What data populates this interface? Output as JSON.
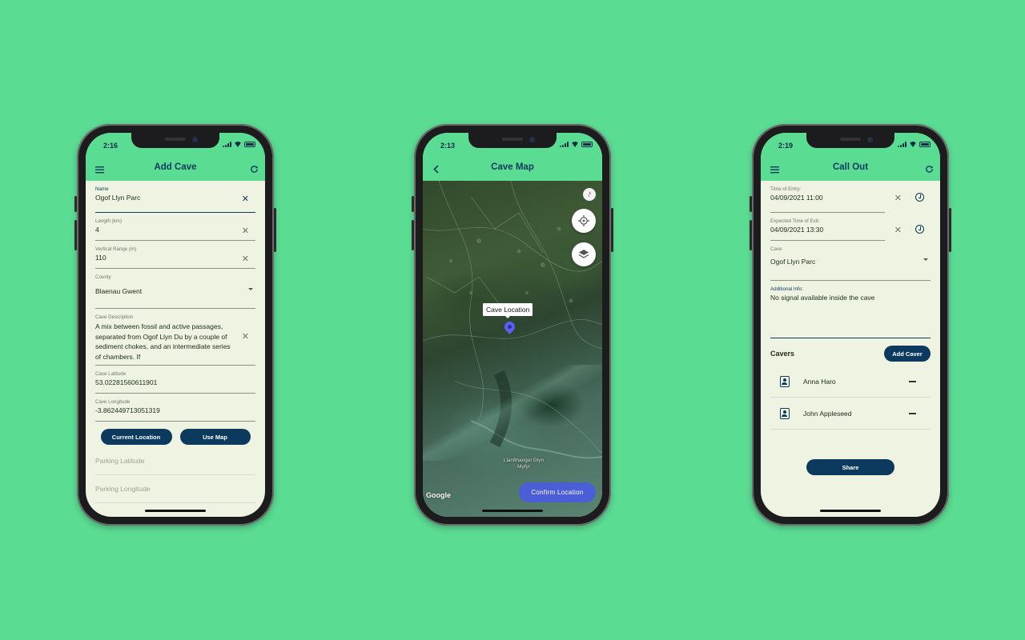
{
  "phones": {
    "add_cave": {
      "status_time": "2:16",
      "title": "Add Cave",
      "name": {
        "label": "Name",
        "value": "Ogof Llyn Parc"
      },
      "length": {
        "label": "Length (km)",
        "value": "4"
      },
      "vertical_range": {
        "label": "Vertical Range (m)",
        "value": "110"
      },
      "county": {
        "label": "County",
        "value": "Blaenau Gwent"
      },
      "description": {
        "label": "Cave Description",
        "value": "A mix between fossil and active passages, separated from Ogof Llyn Du by a couple of sediment chokes, and an intermediate series of chambers. If"
      },
      "latitude": {
        "label": "Cave Latitude",
        "value": "53.02281560611901"
      },
      "longitude": {
        "label": "Cave Longitude",
        "value": "-3.862449713051319"
      },
      "current_location_label": "Current Location",
      "use_map_label": "Use Map",
      "parking_latitude_placeholder": "Parking Latitude",
      "parking_longitude_placeholder": "Parking Longitude"
    },
    "cave_map": {
      "status_time": "2:13",
      "title": "Cave Map",
      "marker_label": "Cave Location",
      "confirm_label": "Confirm Location",
      "google_label": "Google",
      "place_label": "Llanfihangel Glyn Myfyr"
    },
    "call_out": {
      "status_time": "2:19",
      "title": "Call Out",
      "time_of_entry": {
        "label": "Time of Entry:",
        "value": "04/09/2021 11:00"
      },
      "expected_exit": {
        "label": "Expected Time of Exit:",
        "value": "04/09/2021 13:30"
      },
      "cave": {
        "label": "Cave",
        "value": "Ogof Llyn Parc"
      },
      "additional_info": {
        "label": "Additional Info:",
        "value": "No signal available inside the cave"
      },
      "cavers_heading": "Cavers",
      "add_caver_label": "Add Caver",
      "cavers": [
        {
          "name": "Anna Haro"
        },
        {
          "name": "John Appleseed"
        }
      ],
      "share_label": "Share"
    }
  },
  "colors": {
    "background": "#5bdc93",
    "appbar": "#5bdc93",
    "primary": "#0b3a5e",
    "screen_bg": "#eef4e1",
    "map_button": "#4a5ed6"
  },
  "icons": [
    "menu-icon",
    "refresh-icon",
    "back-icon",
    "close-icon",
    "dropdown-icon",
    "clock-icon",
    "person-card-icon",
    "minus-icon",
    "locate-icon",
    "layers-icon",
    "compass-icon",
    "map-pin-icon"
  ]
}
